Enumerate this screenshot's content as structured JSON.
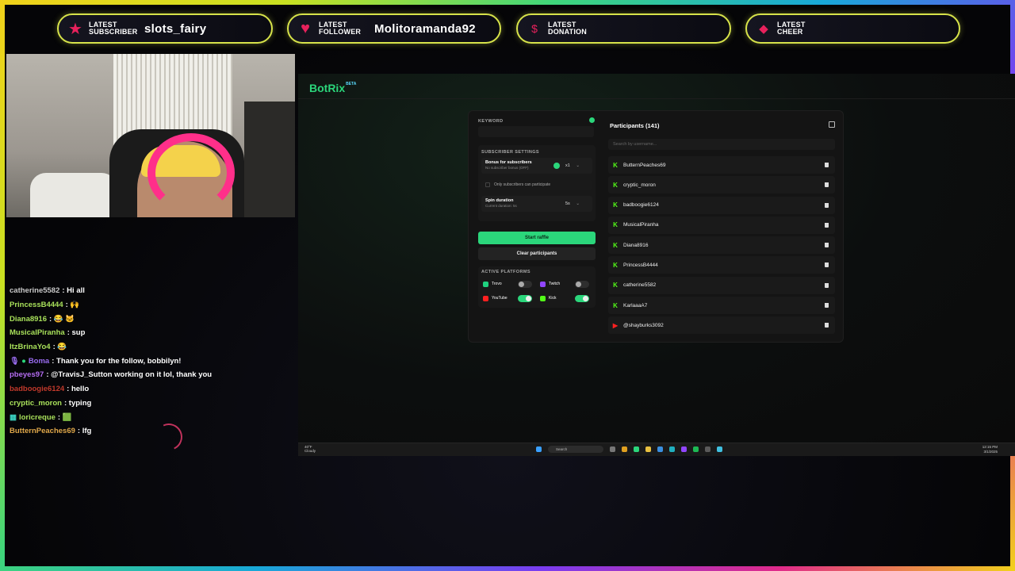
{
  "alerts": [
    {
      "label_line1": "LATEST",
      "label_line2": "SUBSCRIBER",
      "value": "slots_fairy",
      "icon": "star-icon"
    },
    {
      "label_line1": "LATEST",
      "label_line2": "FOLLOWER",
      "value": "Molitoramanda92",
      "icon": "heart-icon"
    },
    {
      "label_line1": "LATEST",
      "label_line2": "DONATION",
      "value": "",
      "icon": "dollar-icon"
    },
    {
      "label_line1": "LATEST",
      "label_line2": "CHEER",
      "value": "",
      "icon": "diamond-icon"
    }
  ],
  "chat": [
    {
      "user": "catherine5582",
      "msg": ": Hi all",
      "color": "#c8c8c8"
    },
    {
      "user": "PrincessB4444",
      "msg": ": 🙌",
      "color": "#a8e05a"
    },
    {
      "user": "Diana8916",
      "msg": ": 😂 🐱",
      "color": "#a8e05a"
    },
    {
      "user": "MusicalPiranha",
      "msg": ": sup",
      "color": "#a8e05a"
    },
    {
      "user": "ItzBrinaYo4",
      "msg": ": 😂",
      "color": "#a8e05a"
    },
    {
      "user": "Boma",
      "msg": ": Thank you for the follow, bobbilyn!",
      "color": "#9a6cf0"
    },
    {
      "user": "pbeyes97",
      "msg": ": @TravisJ_Sutton working on it lol, thank you",
      "color": "#b36cf0"
    },
    {
      "user": "badboogie6124",
      "msg": ": hello",
      "color": "#c0392b"
    },
    {
      "user": "cryptic_moron",
      "msg": ": typing",
      "color": "#a8e05a"
    },
    {
      "user": "loricreque",
      "msg": ": 🟩",
      "color": "#a8e05a"
    },
    {
      "user": "ButternPeaches69",
      "msg": ": lfg",
      "color": "#e0a84a"
    }
  ],
  "botrix": {
    "brand": "BotRix",
    "beta": "BETA",
    "keyword_label": "KEYWORD",
    "sub_settings_label": "SUBSCRIBER SETTINGS",
    "bonus_title": "Bonus for subscribers",
    "bonus_sub": "No subscriber bonus (OFF)",
    "bonus_value": "x1",
    "only_subs": "Only subscribers can participate",
    "spin_title": "Spin duration",
    "spin_sub": "Current duration: 5s",
    "spin_value": "5s",
    "start_button": "Start raffle",
    "clear_button": "Clear participants",
    "platforms_label": "ACTIVE PLATFORMS",
    "platforms": [
      {
        "name": "Trovo",
        "on": false,
        "color": "#1fd17f"
      },
      {
        "name": "Twitch",
        "on": false,
        "color": "#9146ff"
      },
      {
        "name": "YouTube",
        "on": true,
        "color": "#ff2020"
      },
      {
        "name": "Kick",
        "on": true,
        "color": "#53fc18"
      }
    ],
    "participants_title": "Participants (141)",
    "search_placeholder": "Search by username...",
    "participants": [
      {
        "name": "ButternPeaches69",
        "platform": "kick"
      },
      {
        "name": "cryptic_moron",
        "platform": "kick"
      },
      {
        "name": "badboogie6124",
        "platform": "kick"
      },
      {
        "name": "MusicalPiranha",
        "platform": "kick"
      },
      {
        "name": "Diana8916",
        "platform": "kick"
      },
      {
        "name": "PrincessB4444",
        "platform": "kick"
      },
      {
        "name": "catherine5582",
        "platform": "kick"
      },
      {
        "name": "KarlaaaA7",
        "platform": "kick"
      },
      {
        "name": "@shayburks3092",
        "platform": "youtube"
      }
    ]
  },
  "taskbar": {
    "weather_temp": "40°F",
    "weather_desc": "Cloudy",
    "search": "Search",
    "time": "12:15 PM",
    "date": "3/1/2025"
  }
}
